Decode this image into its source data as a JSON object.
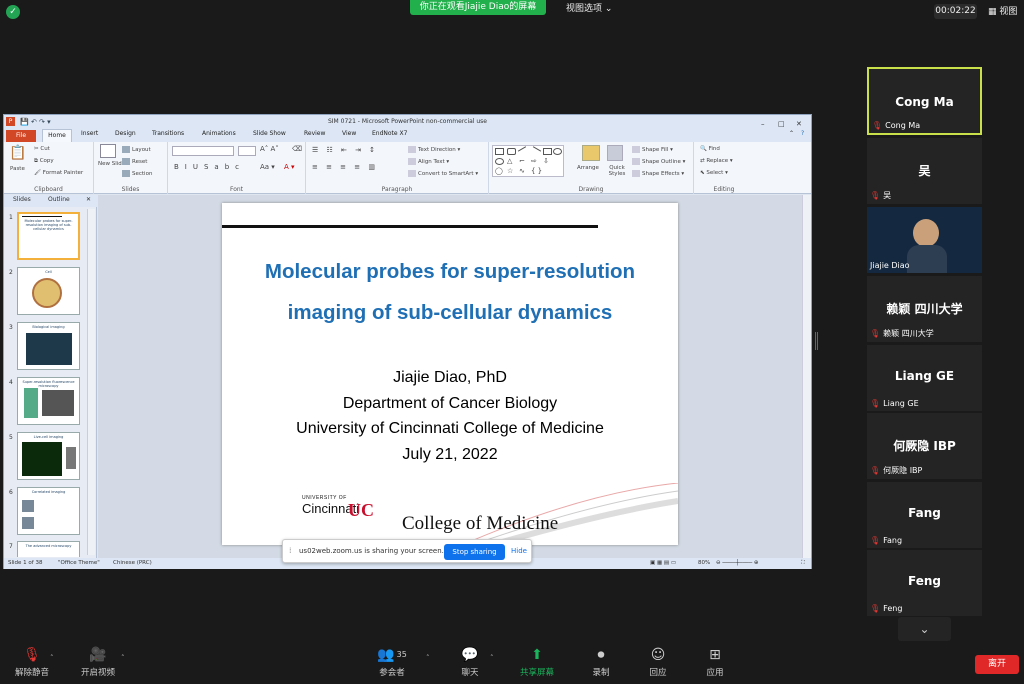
{
  "topbar": {
    "watching": "你正在观看Jiajie Diao的屏幕",
    "view_options": "视图选项",
    "timer": "00:02:22",
    "view": "视图"
  },
  "ppt": {
    "window_title": "SIM 0721 - Microsoft PowerPoint non-commercial use",
    "tabs": [
      "Home",
      "Insert",
      "Design",
      "Transitions",
      "Animations",
      "Slide Show",
      "Review",
      "View",
      "EndNote X7"
    ],
    "file_tab": "File",
    "groups": {
      "clipboard": {
        "label": "Clipboard",
        "paste": "Paste",
        "cut": "Cut",
        "copy": "Copy",
        "format_painter": "Format Painter"
      },
      "slides": {
        "label": "Slides",
        "new_slide": "New Slide",
        "layout": "Layout",
        "reset": "Reset",
        "section": "Section"
      },
      "font": {
        "label": "Font"
      },
      "paragraph": {
        "label": "Paragraph",
        "text_direction": "Text Direction",
        "align_text": "Align Text",
        "smartart": "Convert to SmartArt"
      },
      "drawing": {
        "label": "Drawing",
        "arrange": "Arrange",
        "quick_styles": "Quick Styles",
        "shape_fill": "Shape Fill",
        "shape_outline": "Shape Outline",
        "shape_effects": "Shape Effects"
      },
      "editing": {
        "label": "Editing",
        "find": "Find",
        "replace": "Replace",
        "select": "Select"
      }
    },
    "pane_tabs": [
      "Slides",
      "Outline"
    ],
    "thumbnails": [
      {
        "num": "1",
        "label": "Molecular probes for super-resolution imaging of sub-cellular dynamics"
      },
      {
        "num": "2",
        "label": "Cell"
      },
      {
        "num": "3",
        "label": "Biological imaging"
      },
      {
        "num": "4",
        "label": "Super-resolution fluorescence microscopy"
      },
      {
        "num": "5",
        "label": "Live-cell imaging"
      },
      {
        "num": "6",
        "label": "Correlated imaging"
      },
      {
        "num": "7",
        "label": "The advanced microscopy"
      }
    ],
    "slide": {
      "title_line1": "Molecular probes for super-resolution",
      "title_line2": "imaging of sub-cellular dynamics",
      "author": "Jiajie Diao, PhD",
      "department": "Department of Cancer Biology",
      "university": "University of Cincinnati College of Medicine",
      "date": "July 21, 2022",
      "logo_small": "UNIVERSITY OF",
      "logo_name": "Cincinnati",
      "college": "College of Medicine"
    },
    "status": {
      "slide": "Slide 1 of 38",
      "theme": "\"Office Theme\"",
      "language": "Chinese (PRC)",
      "zoom": "80%"
    }
  },
  "share_banner": {
    "text": "us02web.zoom.us is sharing your screen.",
    "stop": "Stop sharing",
    "hide": "Hide"
  },
  "participants": [
    {
      "name": "Cong Ma",
      "label": "Cong Ma",
      "active": true
    },
    {
      "name": "吴",
      "label": "吴"
    },
    {
      "name": "",
      "label": "Jiajie Diao",
      "video": true
    },
    {
      "name": "赖颖 四川大学",
      "label": "赖颖 四川大学"
    },
    {
      "name": "Liang GE",
      "label": "Liang GE"
    },
    {
      "name": "何厥隐 IBP",
      "label": "何厥隐 IBP"
    },
    {
      "name": "Fang",
      "label": "Fang"
    },
    {
      "name": "Feng",
      "label": "Feng"
    }
  ],
  "toolbar": {
    "unmute": "解除静音",
    "start_video": "开启视频",
    "participants": "参会者",
    "participants_count": "35",
    "chat": "聊天",
    "share": "共享屏幕",
    "record": "录制",
    "reactions": "回应",
    "apps": "应用",
    "leave": "离开"
  },
  "colors": {
    "zoom_green": "#21b04b",
    "accent_blue": "#0e72ed",
    "active_border": "#c9e04a",
    "leave_red": "#e02828",
    "slide_title": "#1f6fb5"
  }
}
